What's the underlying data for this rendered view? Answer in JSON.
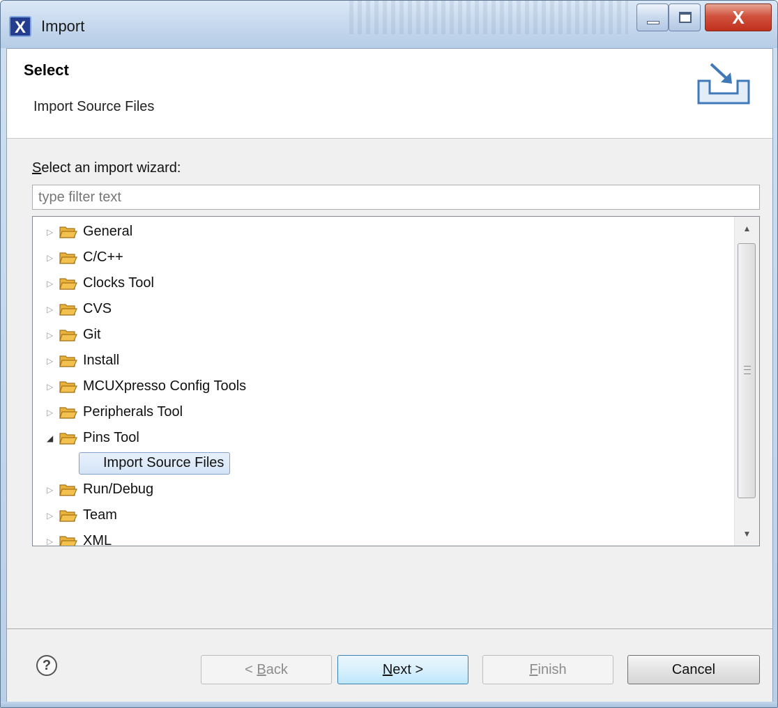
{
  "window": {
    "title": "Import",
    "app_icon_glyph": "X",
    "controls": {
      "minimize": "minimize-icon",
      "maximize": "maximize-icon",
      "close": "X"
    }
  },
  "banner": {
    "title": "Select",
    "description": "Import Source Files",
    "icon": "import-wizard-icon"
  },
  "wizard": {
    "prompt_first": "S",
    "prompt_rest": "elect an import wizard:",
    "filter_placeholder": "type filter text",
    "tree": [
      {
        "label": "General",
        "expanded": false
      },
      {
        "label": "C/C++",
        "expanded": false
      },
      {
        "label": "Clocks Tool",
        "expanded": false
      },
      {
        "label": "CVS",
        "expanded": false
      },
      {
        "label": "Git",
        "expanded": false
      },
      {
        "label": "Install",
        "expanded": false
      },
      {
        "label": "MCUXpresso Config Tools",
        "expanded": false
      },
      {
        "label": "Peripherals Tool",
        "expanded": false
      },
      {
        "label": "Pins Tool",
        "expanded": true
      },
      {
        "label": "Import Source Files",
        "child": true,
        "selected": true
      },
      {
        "label": "Run/Debug",
        "expanded": false
      },
      {
        "label": "Team",
        "expanded": false
      },
      {
        "label": "XML",
        "expanded": false
      }
    ]
  },
  "buttons": {
    "help": "?",
    "back_prefix": "< ",
    "back_mnemonic": "B",
    "back_rest": "ack",
    "next_mnemonic": "N",
    "next_rest": "ext >",
    "finish_mnemonic": "F",
    "finish_rest": "inish",
    "cancel": "Cancel"
  },
  "colors": {
    "selection_border": "#7da2ce",
    "folder_fill": "#f2c14e",
    "primary_button_border": "#3c7fb1",
    "close_button": "#c1301c"
  }
}
